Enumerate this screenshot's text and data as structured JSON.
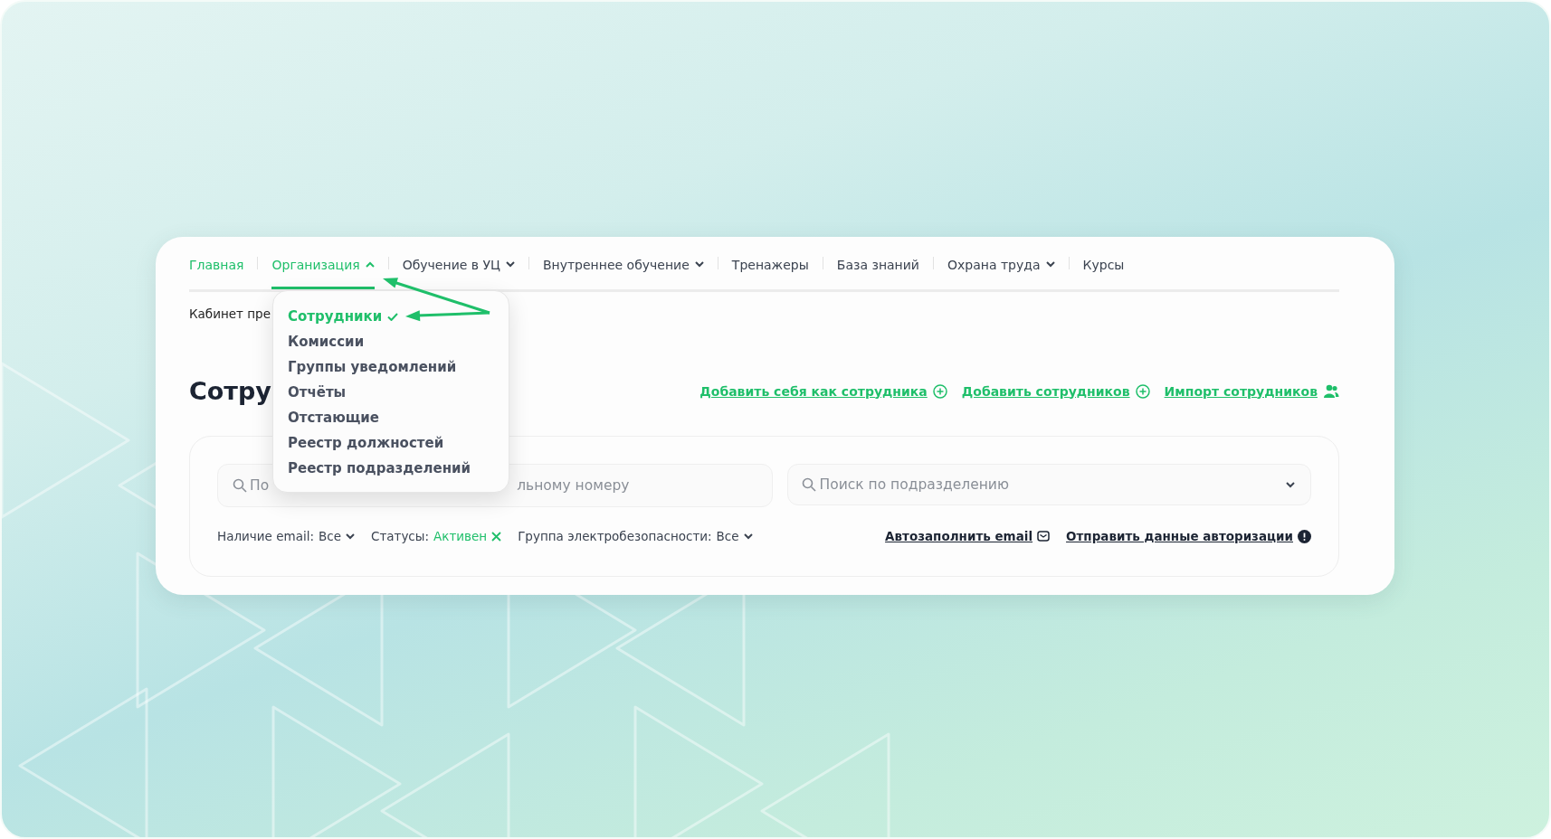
{
  "nav": {
    "items": [
      {
        "label": "Главная",
        "kind": "link",
        "active": true,
        "selected": false
      },
      {
        "label": "Организация",
        "kind": "menu",
        "active": true,
        "selected": true,
        "expanded": true
      },
      {
        "label": "Обучение в УЦ",
        "kind": "menu",
        "active": false,
        "selected": false,
        "expanded": false
      },
      {
        "label": "Внутреннее обучение",
        "kind": "menu",
        "active": false,
        "selected": false,
        "expanded": false
      },
      {
        "label": "Тренажеры",
        "kind": "link",
        "active": false,
        "selected": false
      },
      {
        "label": "База знаний",
        "kind": "link",
        "active": false,
        "selected": false
      },
      {
        "label": "Охрана труда",
        "kind": "menu",
        "active": false,
        "selected": false,
        "expanded": false
      },
      {
        "label": "Курсы",
        "kind": "link",
        "active": false,
        "selected": false
      }
    ]
  },
  "dropdown": {
    "items": [
      {
        "label": "Сотрудники",
        "selected": true
      },
      {
        "label": "Комиссии",
        "selected": false
      },
      {
        "label": "Группы уведомлений",
        "selected": false
      },
      {
        "label": "Отчёты",
        "selected": false
      },
      {
        "label": "Отстающие",
        "selected": false
      },
      {
        "label": "Реестр должностей",
        "selected": false
      },
      {
        "label": "Реестр подразделений",
        "selected": false
      }
    ]
  },
  "breadcrumb": "Кабинет пре",
  "title": "Сотру",
  "actions": [
    {
      "label": "Добавить себя как сотрудника",
      "kind": "plus"
    },
    {
      "label": "Добавить сотрудников",
      "kind": "plus"
    },
    {
      "label": "Импорт сотрудников",
      "kind": "users"
    }
  ],
  "search": [
    {
      "kind": "partial",
      "placeholder_start": "По",
      "placeholder_end": "льному номеру"
    },
    {
      "kind": "select",
      "placeholder": "Поиск по подразделению"
    }
  ],
  "filters": [
    {
      "label": "Наличие email:",
      "value": "Все",
      "kind": "dropdown"
    },
    {
      "label": "Статусы:",
      "value": "Активен",
      "kind": "clearable"
    },
    {
      "label": "Группа электробезопасности:",
      "value": "Все",
      "kind": "dropdown"
    }
  ],
  "links": [
    {
      "label": "Автозаполнить email",
      "kind": "mail"
    },
    {
      "label": "Отправить данные авторизации",
      "kind": "alert"
    }
  ]
}
